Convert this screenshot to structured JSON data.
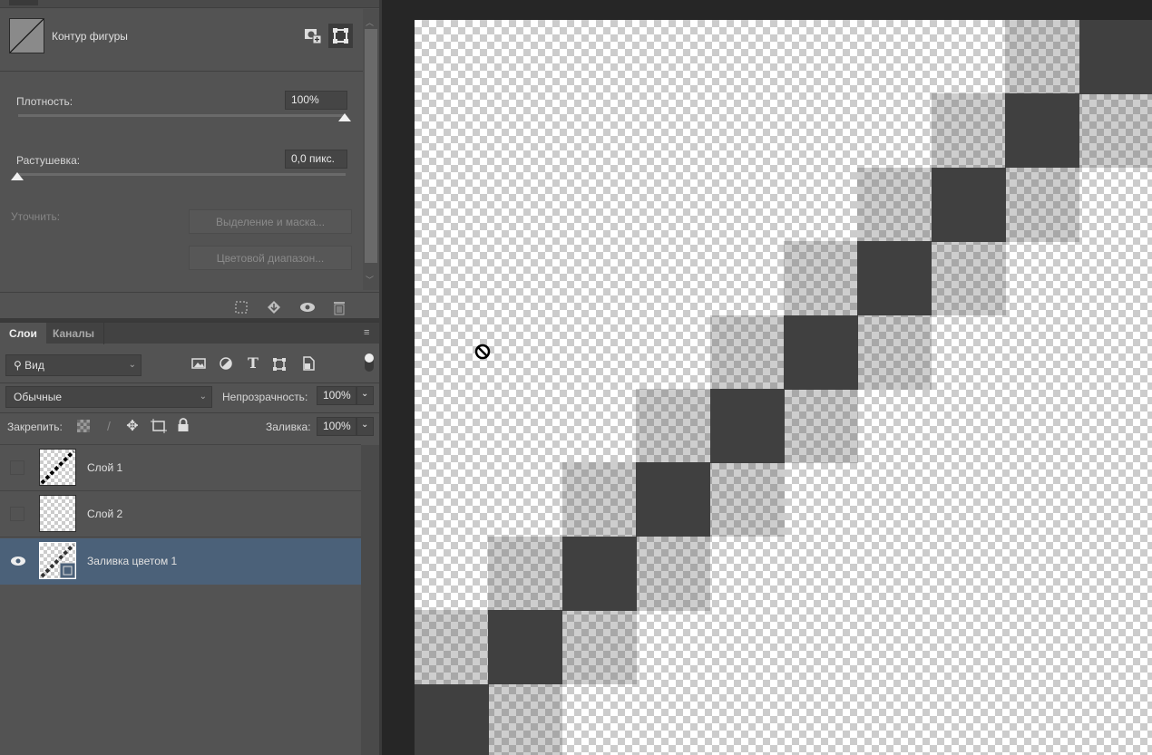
{
  "properties": {
    "title": "Контур фигуры",
    "density_label": "Плотность:",
    "density_value": "100%",
    "density_percent": 100,
    "feather_label": "Растушевка:",
    "feather_value": "0,0 пикс.",
    "feather_percent": 0,
    "refine_label": "Уточнить:",
    "select_mask_button": "Выделение и маска...",
    "color_range_button": "Цветовой диапазон..."
  },
  "layers_panel": {
    "tabs": [
      {
        "label": "Слои",
        "active": true
      },
      {
        "label": "Каналы",
        "active": false
      }
    ],
    "filter_value": "Вид",
    "blend_mode": "Обычные",
    "opacity_label": "Непрозрачность:",
    "opacity_value": "100%",
    "lock_label": "Закрепить:",
    "fill_label": "Заливка:",
    "fill_value": "100%",
    "layers": [
      {
        "name": "Слой 1",
        "visible": false,
        "selected": false
      },
      {
        "name": "Слой 2",
        "visible": false,
        "selected": false
      },
      {
        "name": "Заливка цветом 1",
        "visible": true,
        "selected": true
      }
    ]
  },
  "colors": {
    "panel": "#535353",
    "selected_row": "#4b6179",
    "canvas_bg": "#262626"
  }
}
